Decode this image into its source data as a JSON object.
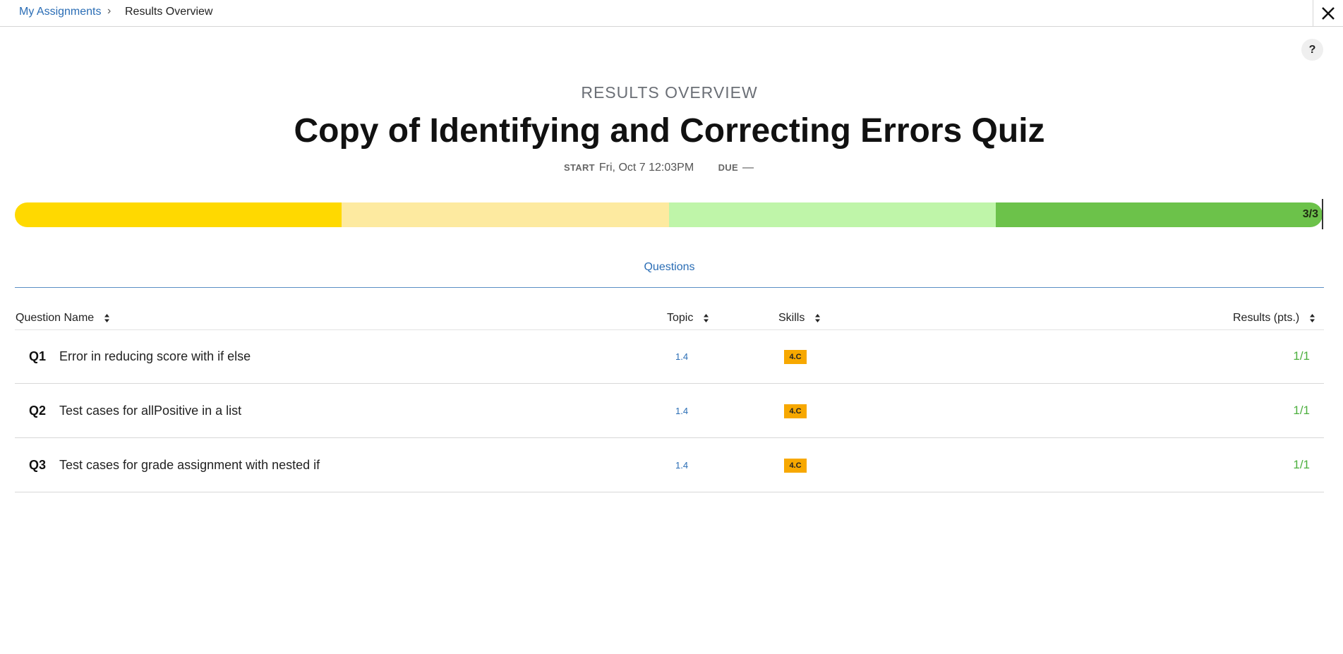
{
  "breadcrumb": {
    "parent": "My Assignments",
    "separator": "›",
    "current": "Results Overview"
  },
  "header": {
    "overline": "RESULTS OVERVIEW",
    "title": "Copy of Identifying and Correcting Errors Quiz",
    "start_label": "START",
    "start_value": "Fri, Oct 7 12:03PM",
    "due_label": "DUE",
    "due_value": "—"
  },
  "help": {
    "label": "?"
  },
  "progress": {
    "score_label": "3/3",
    "earned": 3,
    "total": 3,
    "segment_colors": [
      "#ffd900",
      "#fdeaa0",
      "#bff5a9",
      "#6cc24a"
    ]
  },
  "tabs": {
    "questions": "Questions"
  },
  "table": {
    "columns": {
      "name": "Question Name",
      "topic": "Topic",
      "skills": "Skills",
      "results": "Results (pts.)"
    },
    "rows": [
      {
        "num": "Q1",
        "name": "Error in reducing score with if else",
        "topic": "1.4",
        "skill": "4.C",
        "result": "1/1"
      },
      {
        "num": "Q2",
        "name": "Test cases for allPositive in a list",
        "topic": "1.4",
        "skill": "4.C",
        "result": "1/1"
      },
      {
        "num": "Q3",
        "name": "Test cases for grade assignment with nested if",
        "topic": "1.4",
        "skill": "4.C",
        "result": "1/1"
      }
    ]
  },
  "colors": {
    "link": "#2a6db5",
    "success": "#4caf3e",
    "skill_badge": "#f7a800"
  },
  "icons": {
    "close": "close-icon",
    "sort": "sort-icon",
    "chevron": "chevron-right-icon"
  }
}
